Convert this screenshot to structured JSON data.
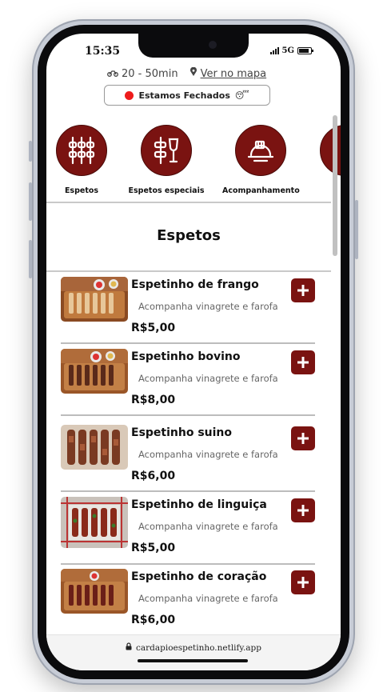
{
  "status_bar": {
    "time": "15:35",
    "network": "5G"
  },
  "header": {
    "delivery_time": "20 - 50min",
    "map_link": "Ver no mapa",
    "status_label": "Estamos Fechados",
    "status_emoji": "😴"
  },
  "categories": [
    {
      "label": "Espetos",
      "icon": "skewers-icon"
    },
    {
      "label": "Espetos especiais",
      "icon": "skewer-glass-icon"
    },
    {
      "label": "Acompanhamento",
      "icon": "side-dish-icon"
    }
  ],
  "section": {
    "title": "Espetos"
  },
  "products": [
    {
      "name": "Espetinho de frango",
      "description": "Acompanha vinagrete e farofa",
      "price": "R$5,00"
    },
    {
      "name": "Espetinho bovino",
      "description": "Acompanha vinagrete e farofa",
      "price": "R$8,00"
    },
    {
      "name": "Espetinho suino",
      "description": "Acompanha vinagrete e farofa",
      "price": "R$6,00"
    },
    {
      "name": "Espetinho de linguiça",
      "description": "Acompanha vinagrete e farofa",
      "price": "R$5,00"
    },
    {
      "name": "Espetinho de coração",
      "description": "Acompanha vinagrete e farofa",
      "price": "R$6,00"
    }
  ],
  "browser": {
    "url": "cardapioespetinho.netlify.app"
  },
  "colors": {
    "brand": "#7a1311",
    "closed_dot": "#ee1c1c"
  }
}
